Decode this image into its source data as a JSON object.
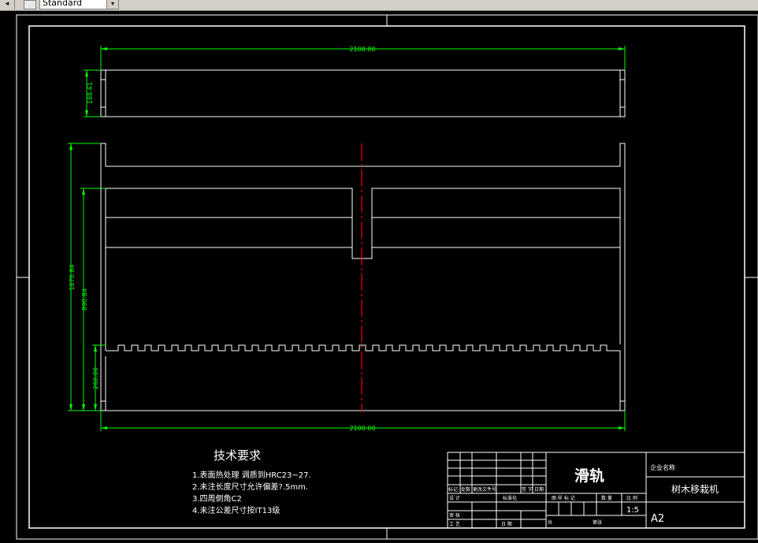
{
  "toolbar": {
    "style_value": "Standard",
    "arrow_glyph": "◂",
    "combo_glyph": "▾"
  },
  "drawing": {
    "dims": {
      "top_width": "2100.00",
      "bottom_width": "2100.00",
      "top_height": "188.61",
      "total_height": "1070.84",
      "mid_height": "890.84",
      "low_height": "260.00"
    },
    "tech_req": {
      "title": "技术要求",
      "items": [
        "1.表面热处理  调质到HRC23~27.",
        "2.未注长度尺寸允许偏差?.5mm.",
        "3.四周倒角C2",
        "4.未注公差尺寸按IT13级"
      ]
    },
    "title_block": {
      "part_name": "滑轨",
      "company_label": "企业名称",
      "drawing_name": "树木移栽机",
      "scale": "1:5",
      "sheet_size": "A2",
      "headers": {
        "mark": "标记",
        "count": "处数",
        "zone": "更改文件号",
        "sign": "签  字",
        "date": "日期",
        "design": "设  计",
        "standardize": "标准化",
        "audit": "审  核",
        "process": "工  艺",
        "date2": "日  期",
        "stage": "图  样  标  记",
        "weight": "数  量",
        "ratio": "比  例",
        "total": "共",
        "sheet": "第张"
      }
    },
    "colors": {
      "outline": "#ffffff",
      "dimension": "#00ff00",
      "centerline": "#ff0000",
      "background": "#000000"
    }
  }
}
